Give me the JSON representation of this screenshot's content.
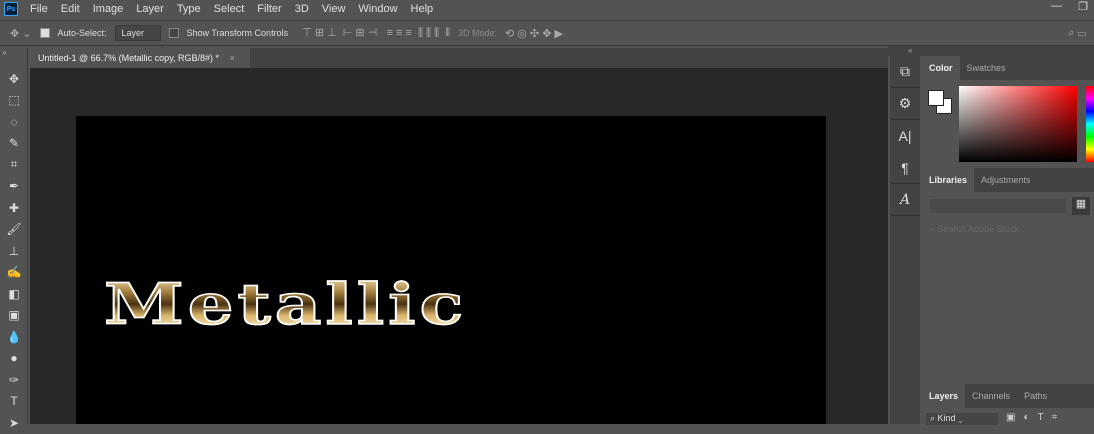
{
  "app": {
    "logo": "Ps"
  },
  "menu": [
    "File",
    "Edit",
    "Image",
    "Layer",
    "Type",
    "Select",
    "Filter",
    "3D",
    "View",
    "Window",
    "Help"
  ],
  "options": {
    "auto_select_label": "Auto-Select:",
    "auto_select_value": "Layer",
    "show_transform": "Show Transform Controls",
    "mode_3d": "3D Mode:"
  },
  "document": {
    "tab_title": "Untitled-1 @ 66.7% (Metallic copy, RGB/8#) *",
    "close": "×",
    "canvas_text": "Metallic"
  },
  "panels": {
    "color_tabs": [
      "Color",
      "Swatches"
    ],
    "library_tabs": [
      "Libraries",
      "Adjustments"
    ],
    "search_placeholder": "Search Adobe Stock",
    "layers_tabs": [
      "Layers",
      "Channels",
      "Paths"
    ],
    "kind_label": "Kind"
  },
  "colors": {
    "hue": "#ff0000"
  }
}
